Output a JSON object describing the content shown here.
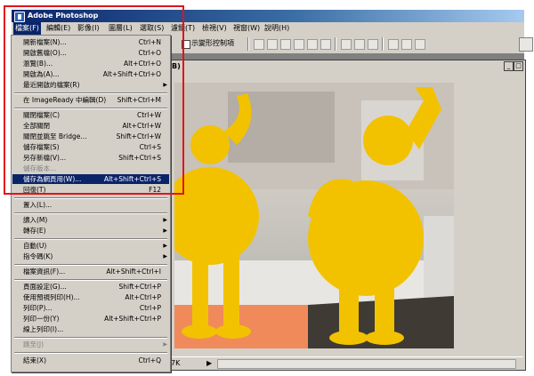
{
  "window": {
    "title": "Adobe Photoshop",
    "doc_title_suffix": "B)"
  },
  "menubar": [
    {
      "label": "檔案(F)",
      "active": true
    },
    {
      "label": "編輯(E)"
    },
    {
      "label": "影像(I)"
    },
    {
      "label": "圖層(L)"
    },
    {
      "label": "選取(S)"
    },
    {
      "label": "濾鏡(T)"
    },
    {
      "label": "檢視(V)"
    },
    {
      "label": "視窗(W)"
    },
    {
      "label": "說明(H)"
    }
  ],
  "toolbar": {
    "show_transform_controls": "示變形控制項"
  },
  "file_menu": {
    "items": [
      {
        "label": "開新檔案(N)...",
        "shortcut": "Ctrl+N"
      },
      {
        "label": "開啟舊檔(O)...",
        "shortcut": "Ctrl+O"
      },
      {
        "label": "瀏覽(B)...",
        "shortcut": "Alt+Ctrl+O"
      },
      {
        "label": "開啟為(A)...",
        "shortcut": "Alt+Shift+Ctrl+O"
      },
      {
        "label": "最近開啟的檔案(R)",
        "submenu": true
      },
      {
        "label": "在 ImageReady 中編輯(D)",
        "shortcut": "Shift+Ctrl+M"
      },
      {
        "label": "關閉檔案(C)",
        "shortcut": "Ctrl+W"
      },
      {
        "label": "全部關閉",
        "shortcut": "Alt+Ctrl+W"
      },
      {
        "label": "關閉並跳至 Bridge...",
        "shortcut": "Shift+Ctrl+W"
      },
      {
        "label": "儲存檔案(S)",
        "shortcut": "Ctrl+S"
      },
      {
        "label": "另存新檔(V)...",
        "shortcut": "Shift+Ctrl+S"
      },
      {
        "label": "儲存版本...",
        "disabled": true
      },
      {
        "label": "儲存為網頁用(W)...",
        "shortcut": "Alt+Shift+Ctrl+S",
        "highlighted": true
      },
      {
        "label": "回復(T)",
        "shortcut": "F12"
      },
      {
        "label": "置入(L)..."
      },
      {
        "label": "讀入(M)",
        "submenu": true
      },
      {
        "label": "轉存(E)",
        "submenu": true
      },
      {
        "label": "自動(U)",
        "submenu": true
      },
      {
        "label": "指令碼(K)",
        "submenu": true
      },
      {
        "label": "檔案資訊(F)...",
        "shortcut": "Alt+Shift+Ctrl+I"
      },
      {
        "label": "頁面設定(G)...",
        "shortcut": "Shift+Ctrl+P"
      },
      {
        "label": "使用預視列印(H)...",
        "shortcut": "Alt+Ctrl+P"
      },
      {
        "label": "列印(P)...",
        "shortcut": "Ctrl+P"
      },
      {
        "label": "列印一份(Y)",
        "shortcut": "Alt+Shift+Ctrl+P"
      },
      {
        "label": "線上列印(I)..."
      },
      {
        "label": "跳至(J)",
        "submenu": true,
        "disabled": true
      },
      {
        "label": "結束(X)",
        "shortcut": "Ctrl+Q"
      }
    ]
  },
  "statusbar": {
    "zoom": "7K",
    "arrow": "▶"
  },
  "colors": {
    "highlight": "#0a246a",
    "menu_bg": "#d4d0c8",
    "annotation_box": "#e3121b",
    "figure_yellow": "#f2c200"
  }
}
